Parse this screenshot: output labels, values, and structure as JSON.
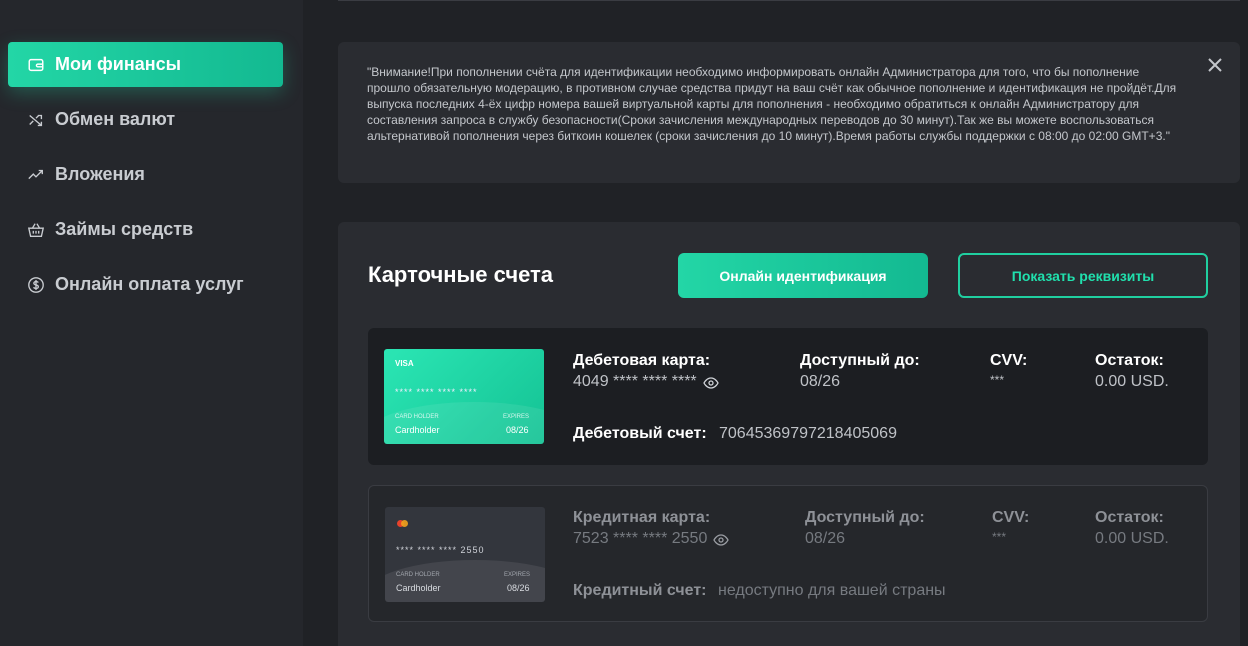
{
  "sidebar": {
    "items": [
      {
        "label": "Мои финансы",
        "icon": "wallet-icon",
        "active": true
      },
      {
        "label": "Обмен валют",
        "icon": "shuffle-icon",
        "active": false
      },
      {
        "label": "Вложения",
        "icon": "trending-up-icon",
        "active": false
      },
      {
        "label": "Займы средств",
        "icon": "basket-icon",
        "active": false
      },
      {
        "label": "Онлайн оплата услуг",
        "icon": "dollar-circle-icon",
        "active": false
      }
    ]
  },
  "alert": {
    "text": "\"Внимание!При пополнении счёта для идентификации необходимо информировать онлайн Администратора для того, что бы пополнение прошло обязательную модерацию, в противном случае средства придут на ваш счёт как обычное пополнение и идентификация не пройдёт.Для выпуска последних 4-ёх цифр номера вашей виртуальной карты для пополнения - необходимо обратиться к онлайн Администратору для составления запроса в службу безопасности(Сроки зачисления международных переводов до 30 минут).Так же вы можете воспользоваться альтернативой пополнения через биткоин кошелек (сроки зачисления до 10 минут).Время работы службы поддержки с 08:00 до 02:00 GMT+3.\"",
    "close_icon": "close-icon"
  },
  "cards_section": {
    "title": "Карточные счета",
    "identify_button": "Онлайн идентификация",
    "details_button": "Показать реквизиты"
  },
  "accounts": [
    {
      "card": {
        "brand": "VISA",
        "number": "**** **** **** ****",
        "holder_label": "CARD HOLDER",
        "holder": "Cardholder",
        "expires_label": "EXPIRES",
        "expires": "08/26"
      },
      "type_label": "Дебетовая карта:",
      "number": "4049 **** **** ****",
      "valid_label": "Доступный до:",
      "valid": "08/26",
      "cvv_label": "CVV:",
      "cvv": "***",
      "balance_label": "Остаток:",
      "balance": "0.00 USD.",
      "account_label": "Дебетовый счет:",
      "account": "7064536979721840506​9"
    },
    {
      "card": {
        "brand": "mastercard",
        "number": "**** **** **** 2550",
        "holder_label": "CARD HOLDER",
        "holder": "Cardholder",
        "expires_label": "EXPIRES",
        "expires": "08/26"
      },
      "type_label": "Кредитная карта:",
      "number": "7523 **** **** 2550",
      "valid_label": "Доступный до:",
      "valid": "08/26",
      "cvv_label": "CVV:",
      "cvv": "***",
      "balance_label": "Остаток:",
      "balance": "0.00 USD.",
      "account_label": "Кредитный счет:",
      "account": "недоступно для вашей страны"
    }
  ],
  "colors": {
    "accent": "#1fd1a1",
    "sidebar_bg": "#25272c",
    "page_bg": "#202226"
  }
}
